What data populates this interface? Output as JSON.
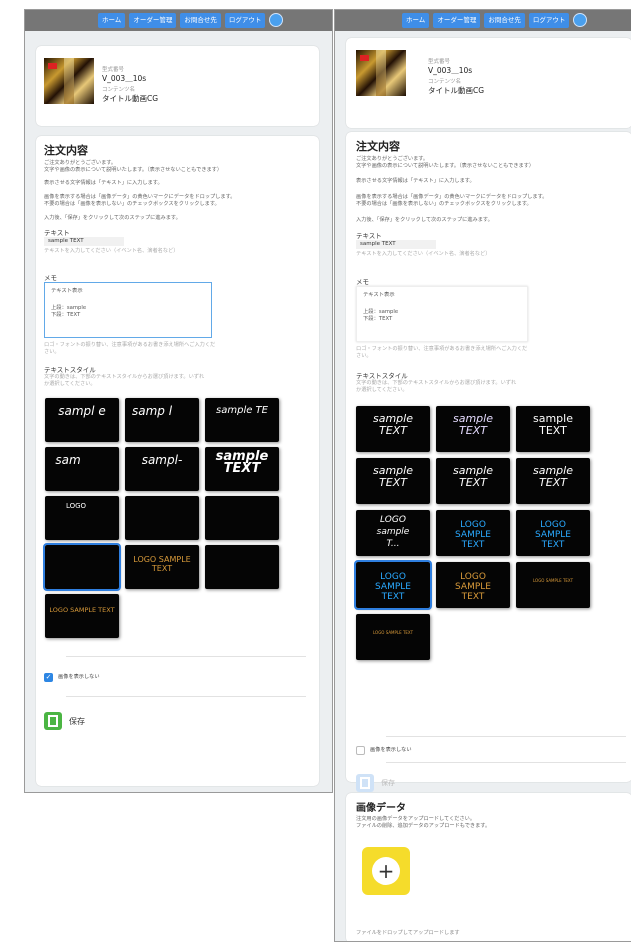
{
  "nav": {
    "items": [
      "ホーム",
      "オーダー管理",
      "お問合せ先",
      "ログアウト"
    ],
    "globe_icon": "globe-icon"
  },
  "product": {
    "label_id": "型式番号",
    "id_value": "V_003＿10s",
    "label_content": "コンテンツ名",
    "content_value": "タイトル動画CG"
  },
  "order": {
    "title": "注文内容",
    "intro1": "ご注文ありがとうございます。",
    "intro2": "文字や画像の表示について説明いたします。（表示させないこともできます）",
    "p2": "表示させる文字情報は「テキスト」に入力します。",
    "p3a": "画像を表示する場合は「画像データ」の黄色いマークにデータをドロップします。",
    "p3b": "不要の場合は「画像を表示しない」のチェックボックスをクリックします。",
    "p4": "入力後、「保存」をクリックして次のステップに進みます。",
    "text_label": "テキスト",
    "text_value": "sample TEXT",
    "text_hint": "テキストを入力してください（イベント名、演者名など）",
    "memo_label": "メモ",
    "memo_lines": [
      "テキスト表示",
      "上段：sample",
      "下段：TEXT"
    ],
    "memo_hint1": "ロゴ・フォントの振り替い、注意事項があるお書き添え場所へご入力くだ",
    "memo_hint2": "さい。",
    "style_label": "テキストスタイル",
    "style_hint1": "文字の動きは、下部のテキストスタイルからお選び頂けます。いずれ",
    "style_hint2": "か選択してください。",
    "no_image_label": "画像を表示しない",
    "save_label": "保存"
  },
  "left_tiles": [
    "sampl e",
    "samp l",
    "sample TE",
    "sam",
    "sampl-",
    "sample TEXT",
    "LOGO",
    "",
    "",
    "",
    "LOGO SAMPLE TEXT",
    "",
    "LOGO SAMPLE TEXT"
  ],
  "right_tiles": [
    "sample TEXT",
    "sample TEXT",
    "sample TEXT",
    "sample TEXT",
    "sample TEXT",
    "sample TEXT",
    "LOGO sample T...",
    "LOGO SAMPLE TEXT",
    "LOGO SAMPLE TEXT",
    "LOGO SAMPLE TEXT",
    "LOGO SAMPLE TEXT",
    "LOGO SAMPLE TEXT",
    "LOGO SAMPLE TEXT"
  ],
  "image_data": {
    "title": "画像データ",
    "p1": "注文用の画像データをアップロードしてください。",
    "p2": "ファイルの削除、追加データのアップロードもできます。",
    "drop": "ファイルをドロップしてアップロードします"
  },
  "colors": {
    "accent": "#2d86e3",
    "nav": "#767676",
    "save_active": "#4bb543",
    "upload": "#f5dc2b"
  }
}
